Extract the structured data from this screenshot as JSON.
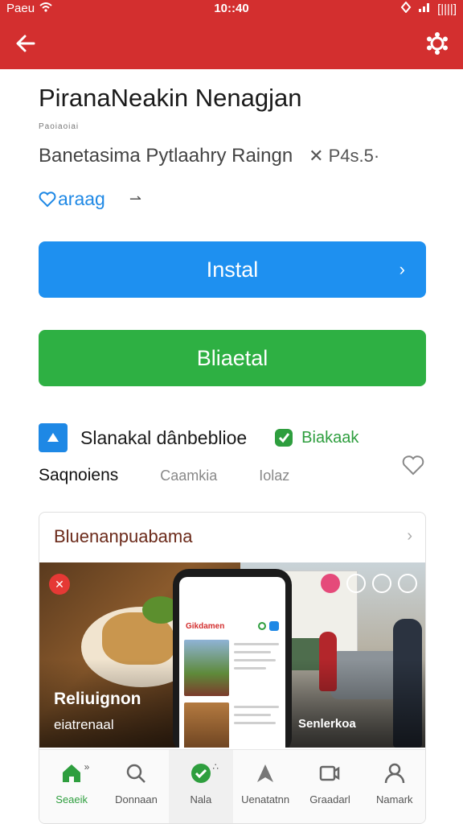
{
  "status_bar": {
    "carrier": "Paeu",
    "time": "10::40",
    "battery_label": "[||||]"
  },
  "app_bar": {
    "back_icon": "arrow-left-icon",
    "settings_icon": "gear-icon",
    "color": "#d32f2f"
  },
  "app": {
    "title": "PiranaNeakin Nenagjan",
    "small_caption": "Paoiaoiai",
    "rating_text": "Banetasima Pytlaahry Raingn",
    "rating_prefix": "✕",
    "rating_value": "P4s.5·",
    "favorite_label": "araag",
    "favorite_arrow": "⇀"
  },
  "buttons": {
    "install_label": "Instal",
    "install_color": "#1e90f0",
    "secondary_label": "Bliaetal",
    "secondary_color": "#2eb043"
  },
  "developer": {
    "name": "Slanakal dânbeblioe",
    "badge_label": "Biakaak"
  },
  "tabs": {
    "items": [
      "Saqnoiens",
      "Caamkia",
      "Iolaz"
    ]
  },
  "card": {
    "title": "Bluenanpuabama",
    "caption_left_title": "Reliuignon",
    "caption_left_sub": "eiatrenaal",
    "caption_right": "Senlerkoa",
    "phone_header": "Gikdamen",
    "overlay_close": "✕"
  },
  "bottom_nav": {
    "items": [
      {
        "label": "Seaeik",
        "icon": "home-icon"
      },
      {
        "label": "Donnaan",
        "icon": "search-icon"
      },
      {
        "label": "Nala",
        "icon": "check-circle-icon"
      },
      {
        "label": "Uenatatnn",
        "icon": "navigation-icon"
      },
      {
        "label": "Graadarl",
        "icon": "video-icon"
      },
      {
        "label": "Namark",
        "icon": "person-icon"
      }
    ],
    "active_color": "#2e9e3e"
  }
}
